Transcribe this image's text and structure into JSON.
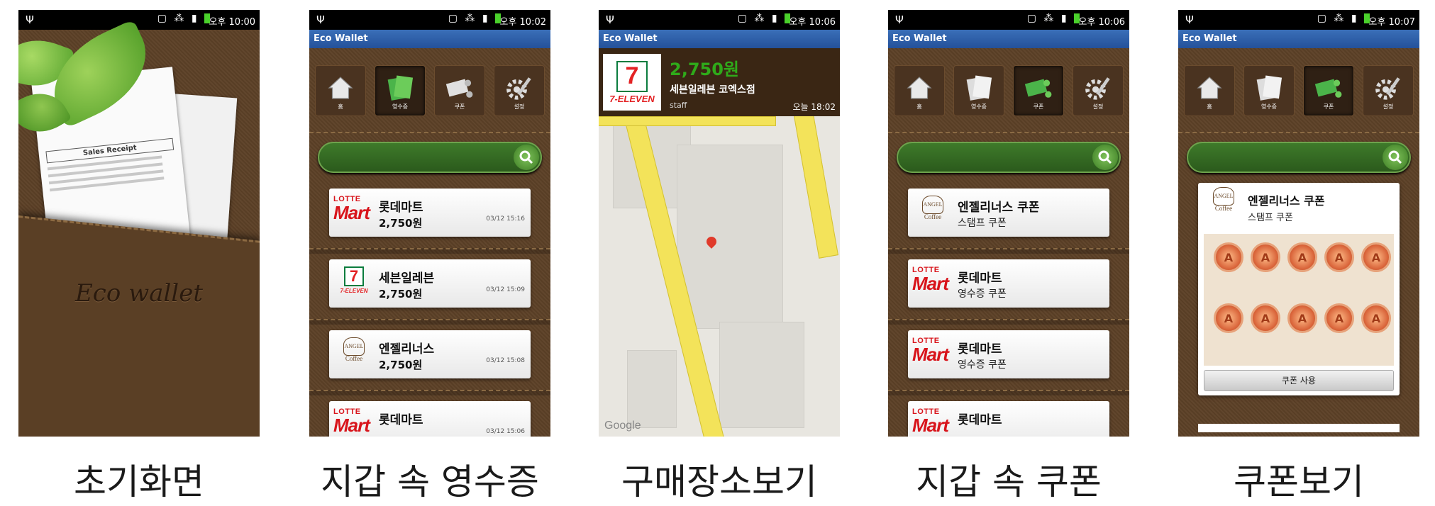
{
  "panels": [
    {
      "caption": "초기화면"
    },
    {
      "caption": "지갑 속 영수증"
    },
    {
      "caption": "구매장소보기"
    },
    {
      "caption": "지갑 속 쿠폰"
    },
    {
      "caption": "쿠폰보기"
    }
  ],
  "status": {
    "times": [
      "오후 10:00",
      "오후 10:02",
      "오후 10:06",
      "오후 10:06",
      "오후 10:07"
    ]
  },
  "app": {
    "title": "Eco Wallet"
  },
  "splash": {
    "title": "Eco wallet",
    "receipt_title": "Sales Receipt"
  },
  "toolbar_labels": [
    "홈",
    "영수증",
    "쿠폰",
    "설정"
  ],
  "receipts": [
    {
      "store": "롯데마트",
      "amount": "2,750원",
      "date": "03/12 15:16",
      "logo": "lotte"
    },
    {
      "store": "세븐일레븐",
      "amount": "2,750원",
      "date": "03/12 15:09",
      "logo": "seven"
    },
    {
      "store": "엔젤리너스",
      "amount": "2,750원",
      "date": "03/12 15:08",
      "logo": "angel"
    },
    {
      "store": "롯데마트",
      "amount": "",
      "date": "03/12 15:06",
      "logo": "lotte"
    }
  ],
  "purchase_place": {
    "amount": "2,750원",
    "store": "세븐일레븐 코엑스점",
    "staff": "staff",
    "when": "오늘 18:02",
    "map_credit": "Google"
  },
  "coupons": [
    {
      "store": "엔젤리너스 쿠폰",
      "type": "스탬프 쿠폰",
      "logo": "angel"
    },
    {
      "store": "롯데마트",
      "type": "영수증 쿠폰",
      "logo": "lotte"
    },
    {
      "store": "롯데마트",
      "type": "영수증 쿠폰",
      "logo": "lotte"
    },
    {
      "store": "롯데마트",
      "type": "",
      "logo": "lotte"
    }
  ],
  "coupon_view": {
    "store": "엔젤리너스 쿠폰",
    "type": "스탬프 쿠폰",
    "stamp_count": 10,
    "use_button": "쿠폰 사용"
  },
  "logos": {
    "lotte_top": "LOTTE",
    "lotte_bottom": "Mart",
    "seven_num": "7",
    "seven_word": "7-ELEVEN",
    "angel_top": "ANGEL",
    "angel_bottom": "Coffee"
  },
  "colors": {
    "leather": "#5c4026",
    "search_green": "#3e7a2a",
    "amount_green": "#2faa1a",
    "appbar_blue": "#24519a"
  }
}
